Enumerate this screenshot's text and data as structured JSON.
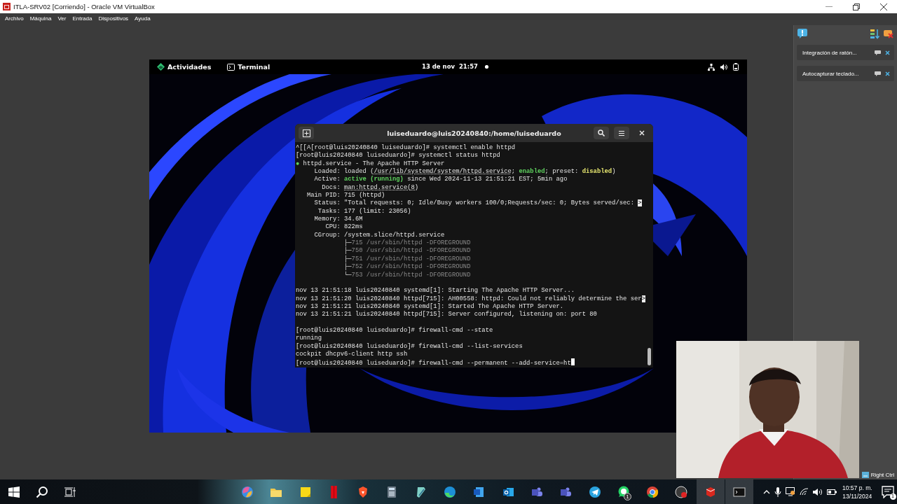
{
  "window": {
    "title": "ITLA-SRV02 [Corriendo] - Oracle VM VirtualBox"
  },
  "menu": [
    "Archivo",
    "Máquina",
    "Ver",
    "Entrada",
    "Dispositivos",
    "Ayuda"
  ],
  "guest_topbar": {
    "activities": "Actividades",
    "app": "Terminal",
    "clock": "13 de nov  21:57"
  },
  "terminal": {
    "title": "luiseduardo@luis20240840:/home/luiseduardo",
    "lines": [
      {
        "parts": [
          {
            "text": "^[[A[root@luis20240840 luiseduardo]# systemctl enable httpd",
            "kind": "plain"
          }
        ]
      },
      {
        "parts": [
          {
            "text": "[root@luis20240840 luiseduardo]# systemctl status httpd",
            "kind": "plain"
          }
        ]
      },
      {
        "parts": [
          {
            "text": "●",
            "kind": "green"
          },
          {
            "text": " httpd.service - The Apache HTTP Server",
            "kind": "plain"
          }
        ]
      },
      {
        "parts": [
          {
            "text": "     Loaded: loaded (",
            "kind": "plain"
          },
          {
            "text": "/usr/lib/systemd/system/httpd.service",
            "kind": "link"
          },
          {
            "text": "; ",
            "kind": "plain"
          },
          {
            "text": "enabled",
            "kind": "green"
          },
          {
            "text": "; preset: ",
            "kind": "plain"
          },
          {
            "text": "disabled",
            "kind": "yellow"
          },
          {
            "text": ")",
            "kind": "plain"
          }
        ]
      },
      {
        "parts": [
          {
            "text": "     Active: ",
            "kind": "plain"
          },
          {
            "text": "active (running)",
            "kind": "green"
          },
          {
            "text": " since Wed 2024-11-13 21:51:21 EST; 5min ago",
            "kind": "plain"
          }
        ]
      },
      {
        "parts": [
          {
            "text": "       Docs: ",
            "kind": "plain"
          },
          {
            "text": "man:httpd.service(8)",
            "kind": "link"
          }
        ]
      },
      {
        "parts": [
          {
            "text": "   Main PID: 715 (httpd)",
            "kind": "plain"
          }
        ]
      },
      {
        "parts": [
          {
            "text": "     Status: \"Total requests: 0; Idle/Busy workers 100/0;Requests/sec: 0; Bytes served/sec: ",
            "kind": "plain"
          },
          {
            "text": ">",
            "kind": "marker"
          }
        ]
      },
      {
        "parts": [
          {
            "text": "      Tasks: 177 (limit: 23056)",
            "kind": "plain"
          }
        ]
      },
      {
        "parts": [
          {
            "text": "     Memory: 34.6M",
            "kind": "plain"
          }
        ]
      },
      {
        "parts": [
          {
            "text": "        CPU: 822ms",
            "kind": "plain"
          }
        ]
      },
      {
        "parts": [
          {
            "text": "     CGroup: /system.slice/httpd.service",
            "kind": "plain"
          }
        ]
      },
      {
        "parts": [
          {
            "text": "             ├─",
            "kind": "plain"
          },
          {
            "text": "715 /usr/sbin/httpd -DFOREGROUND",
            "kind": "dim"
          }
        ]
      },
      {
        "parts": [
          {
            "text": "             ├─",
            "kind": "plain"
          },
          {
            "text": "750 /usr/sbin/httpd -DFOREGROUND",
            "kind": "dim"
          }
        ]
      },
      {
        "parts": [
          {
            "text": "             ├─",
            "kind": "plain"
          },
          {
            "text": "751 /usr/sbin/httpd -DFOREGROUND",
            "kind": "dim"
          }
        ]
      },
      {
        "parts": [
          {
            "text": "             ├─",
            "kind": "plain"
          },
          {
            "text": "752 /usr/sbin/httpd -DFOREGROUND",
            "kind": "dim"
          }
        ]
      },
      {
        "parts": [
          {
            "text": "             └─",
            "kind": "plain"
          },
          {
            "text": "753 /usr/sbin/httpd -DFOREGROUND",
            "kind": "dim"
          }
        ]
      },
      {
        "kind": "blank"
      },
      {
        "parts": [
          {
            "text": "nov 13 21:51:18 luis20240840 systemd[1]: Starting The Apache HTTP Server...",
            "kind": "plain"
          }
        ]
      },
      {
        "parts": [
          {
            "text": "nov 13 21:51:20 luis20240840 httpd[715]: AH00558: httpd: Could not reliably determine the ser",
            "kind": "plain"
          },
          {
            "text": ">",
            "kind": "marker"
          }
        ]
      },
      {
        "parts": [
          {
            "text": "nov 13 21:51:21 luis20240840 systemd[1]: Started The Apache HTTP Server.",
            "kind": "plain"
          }
        ]
      },
      {
        "parts": [
          {
            "text": "nov 13 21:51:21 luis20240840 httpd[715]: Server configured, listening on: port 80",
            "kind": "plain"
          }
        ]
      },
      {
        "kind": "blank"
      },
      {
        "parts": [
          {
            "text": "[root@luis20240840 luiseduardo]# firewall-cmd --state",
            "kind": "plain"
          }
        ]
      },
      {
        "parts": [
          {
            "text": "running",
            "kind": "plain"
          }
        ]
      },
      {
        "parts": [
          {
            "text": "[root@luis20240840 luiseduardo]# firewall-cmd --list-services",
            "kind": "plain"
          }
        ]
      },
      {
        "parts": [
          {
            "text": "cockpit dhcpv6-client http ssh",
            "kind": "plain"
          }
        ]
      },
      {
        "parts": [
          {
            "text": "[root@luis20240840 luiseduardo]# firewall-cmd --permanent --add-service=ht",
            "kind": "plain"
          }
        ],
        "cursor": true
      }
    ]
  },
  "side_panel": {
    "notifications": [
      "Integración de ratón...",
      "Autocapturar teclado..."
    ],
    "host_key": "Right Ctrl"
  },
  "webcam": {
    "kind": "picture"
  },
  "taskbar": {
    "apps": [
      {
        "kind": "swirl",
        "selected": false
      },
      {
        "kind": "folder",
        "selected": false
      },
      {
        "kind": "note",
        "selected": false
      },
      {
        "kind": "ribbon",
        "selected": false
      },
      {
        "kind": "shield",
        "selected": false
      },
      {
        "kind": "calculator",
        "selected": false
      },
      {
        "kind": "notepad",
        "selected": false
      },
      {
        "kind": "wave",
        "selected": false
      },
      {
        "kind": "document",
        "selected": false
      },
      {
        "kind": "mail",
        "selected": false
      },
      {
        "kind": "people",
        "selected": false
      },
      {
        "kind": "people",
        "selected": false
      },
      {
        "kind": "plane",
        "selected": false
      },
      {
        "kind": "chat",
        "selected": false,
        "badge": "1"
      },
      {
        "kind": "browser",
        "selected": false
      },
      {
        "kind": "record",
        "selected": false
      },
      {
        "kind": "cube",
        "selected": true
      },
      {
        "kind": "terminal",
        "selected": true
      }
    ],
    "time": "10:57 p. m.",
    "date": "13/11/2024",
    "notifications": "1"
  }
}
